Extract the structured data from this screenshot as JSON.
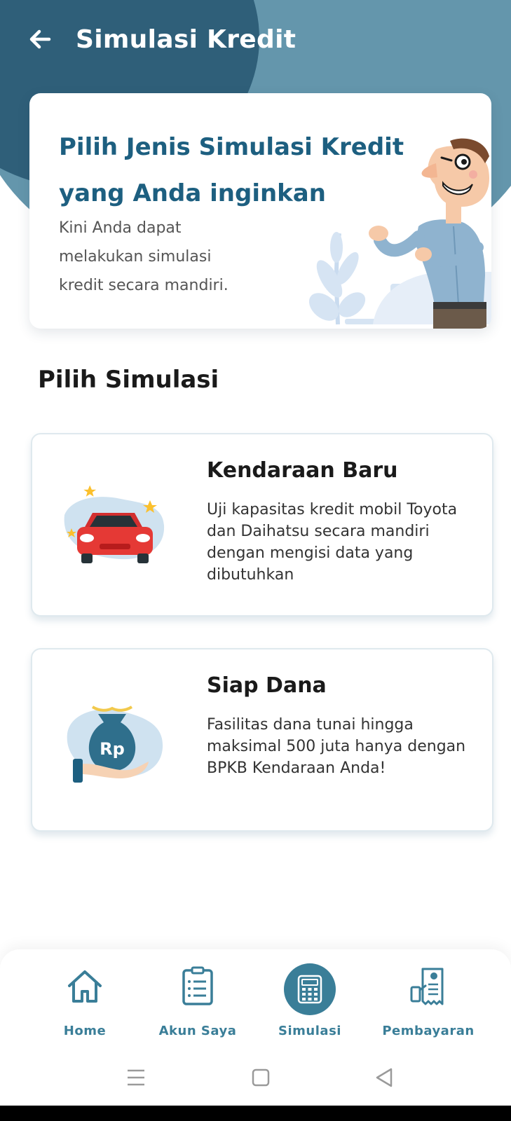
{
  "header": {
    "title": "Simulasi Kredit",
    "back_icon": "arrow-left-icon"
  },
  "promo": {
    "title_line1": "Pilih Jenis Simulasi Kredit",
    "title_line2": "yang Anda inginkan",
    "desc_line1": "Kini Anda dapat",
    "desc_line2": "melakukan simulasi",
    "desc_line3": "kredit secara mandiri."
  },
  "section": {
    "title": "Pilih Simulasi"
  },
  "options": [
    {
      "title": "Kendaraan Baru",
      "description": "Uji kapasitas kredit mobil Toyota dan Daihatsu secara mandiri dengan mengisi data yang dibutuhkan",
      "icon": "car-icon"
    },
    {
      "title": "Siap Dana",
      "description": "Fasilitas dana tunai hingga maksimal 500 juta hanya dengan BPKB Kendaraan Anda!",
      "icon": "money-bag-icon",
      "icon_text": "Rp"
    }
  ],
  "bottom_nav": {
    "items": [
      {
        "label": "Home",
        "icon": "home-icon"
      },
      {
        "label": "Akun Saya",
        "icon": "clipboard-icon"
      },
      {
        "label": "Simulasi",
        "icon": "calculator-icon",
        "active": true
      },
      {
        "label": "Pembayaran",
        "icon": "receipt-icon"
      }
    ]
  },
  "colors": {
    "header_dark": "#2f5f79",
    "header_light": "#6496ac",
    "accent": "#3a7e98",
    "promo_title": "#1d5f80",
    "car_red": "#e53935"
  }
}
